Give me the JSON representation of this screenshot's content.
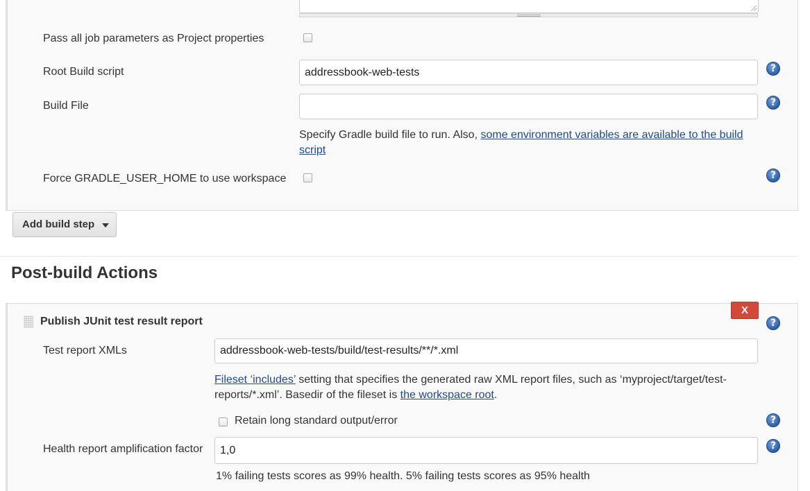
{
  "gradle_build_step": {
    "pass_params_label": "Pass all job parameters as Project properties",
    "root_build_script_label": "Root Build script",
    "root_build_script_value": "addressbook-web-tests",
    "build_file_label": "Build File",
    "build_file_value": "",
    "build_file_help_prefix": "Specify Gradle build file to run. Also,",
    "build_file_help_link": "some environment variables are available to the build script",
    "force_home_label": "Force GRADLE_USER_HOME to use workspace"
  },
  "add_build_step": {
    "label": "Add build step"
  },
  "post_build": {
    "title": "Post-build Actions",
    "junit": {
      "title": "Publish JUnit test result report",
      "delete_label": "X",
      "test_report_label": "Test report XMLs",
      "test_report_value": "addressbook-web-tests/build/test-results/**/*.xml",
      "fileset_link": "Fileset ‘includes’",
      "fileset_help_mid": "setting that specifies the generated raw XML report files, such as ‘myproject/target/test-reports/*.xml’. Basedir of the fileset is",
      "workspace_root_link": "the workspace root",
      "fileset_help_end": ".",
      "retain_label": "Retain long standard output/error",
      "health_label": "Health report amplification factor",
      "health_value": "1,0",
      "health_help": "1% failing tests scores as 99% health. 5% failing tests scores as 95% health"
    }
  },
  "icons": {
    "help": "?"
  },
  "colors": {
    "link": "#204a87",
    "delete_button": "#d24939",
    "help_icon": "#2c5fa8"
  }
}
